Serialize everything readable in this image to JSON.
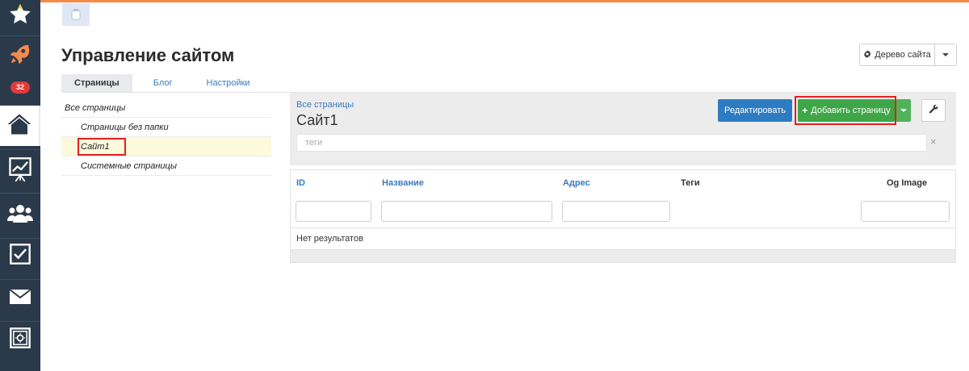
{
  "nav": {
    "badge_count": "32",
    "items": [
      {
        "icon": "star-icon"
      },
      {
        "icon": "rocket-icon"
      },
      {
        "icon": "notification-badge"
      },
      {
        "icon": "home-icon"
      },
      {
        "icon": "chart-icon"
      },
      {
        "icon": "users-icon"
      },
      {
        "icon": "checkbox-icon"
      },
      {
        "icon": "mail-icon"
      },
      {
        "icon": "safe-icon"
      }
    ]
  },
  "colors": {
    "sidebar": "#2b3a4a",
    "accent_orange": "#f58a4b",
    "primary_blue": "#2d7cc1",
    "success_green": "#3fa648",
    "highlight_red": "#e0201c"
  },
  "header": {
    "title": "Управление сайтом",
    "site_tree_button": "Дерево сайта"
  },
  "tabs": [
    {
      "label": "Страницы",
      "active": true
    },
    {
      "label": "Блог",
      "active": false
    },
    {
      "label": "Настройки",
      "active": false
    }
  ],
  "tree": {
    "root": "Все страницы",
    "items": [
      "Страницы без папки",
      "Сайт1",
      "Системные страницы"
    ],
    "selected": "Сайт1"
  },
  "panel": {
    "breadcrumb": "Все страницы",
    "title": "Сайт1",
    "edit_button": "Редактировать",
    "add_button": "Добавить страницу",
    "tags_placeholder": "теги",
    "clear_symbol": "×"
  },
  "table": {
    "columns": [
      "ID",
      "Название",
      "Адрес",
      "Теги",
      "Og Image"
    ],
    "empty_message": "Нет результатов"
  }
}
